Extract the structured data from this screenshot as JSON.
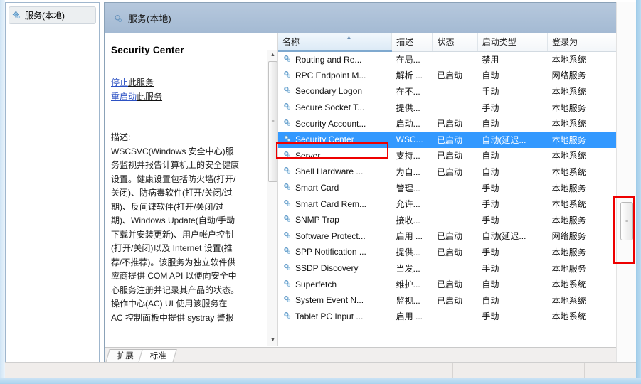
{
  "window": {
    "header_title": "服务(本地)",
    "header_icon": "service-gear-icon"
  },
  "tree": {
    "items": [
      {
        "label": "服务(本地)",
        "icon": "service-gear-icon"
      }
    ]
  },
  "detail": {
    "title": "Security Center",
    "links": [
      {
        "underlined": "停止",
        "rest": "此服务"
      },
      {
        "underlined": "重启动",
        "rest": "此服务"
      }
    ],
    "description_label": "描述:",
    "description_lines": [
      "WSCSVC(Windows 安全中心)服",
      "务监视并报告计算机上的安全健康",
      "设置。健康设置包括防火墙(打开/",
      "关闭)、防病毒软件(打开/关闭/过",
      "期)、反间谍软件(打开/关闭/过",
      "期)、Windows Update(自动/手动",
      "下载并安装更新)、用户帐户控制",
      "(打开/关闭)以及 Internet 设置(推",
      "荐/不推荐)。该服务为独立软件供",
      "应商提供 COM API 以便向安全中",
      "心服务注册并记录其产品的状态。",
      "操作中心(AC) UI 使用该服务在",
      "AC 控制面板中提供 systray 警报"
    ]
  },
  "list": {
    "columns": [
      {
        "label": "名称",
        "sorted": true,
        "sort_direction": "asc"
      },
      {
        "label": "描述",
        "sorted": false
      },
      {
        "label": "状态",
        "sorted": false
      },
      {
        "label": "启动类型",
        "sorted": false
      },
      {
        "label": "登录为",
        "sorted": false
      },
      {
        "label": "",
        "sorted": false
      }
    ],
    "rows": [
      {
        "name": "Routing and Re...",
        "description": "在局...",
        "status": "",
        "startup": "禁用",
        "logon": "本地系统",
        "selected": false
      },
      {
        "name": "RPC Endpoint M...",
        "description": "解析 ...",
        "status": "已启动",
        "startup": "自动",
        "logon": "网络服务",
        "selected": false
      },
      {
        "name": "Secondary Logon",
        "description": "在不...",
        "status": "",
        "startup": "手动",
        "logon": "本地系统",
        "selected": false
      },
      {
        "name": "Secure Socket T...",
        "description": "提供...",
        "status": "",
        "startup": "手动",
        "logon": "本地服务",
        "selected": false
      },
      {
        "name": "Security Account...",
        "description": "启动...",
        "status": "已启动",
        "startup": "自动",
        "logon": "本地系统",
        "selected": false
      },
      {
        "name": "Security Center",
        "description": "WSC...",
        "status": "已启动",
        "startup": "自动(延迟...",
        "logon": "本地服务",
        "selected": true
      },
      {
        "name": "Server",
        "description": "支持...",
        "status": "已启动",
        "startup": "自动",
        "logon": "本地系统",
        "selected": false
      },
      {
        "name": "Shell Hardware ...",
        "description": "为自...",
        "status": "已启动",
        "startup": "自动",
        "logon": "本地系统",
        "selected": false
      },
      {
        "name": "Smart Card",
        "description": "管理...",
        "status": "",
        "startup": "手动",
        "logon": "本地服务",
        "selected": false
      },
      {
        "name": "Smart Card Rem...",
        "description": "允许...",
        "status": "",
        "startup": "手动",
        "logon": "本地系统",
        "selected": false
      },
      {
        "name": "SNMP Trap",
        "description": "接收...",
        "status": "",
        "startup": "手动",
        "logon": "本地服务",
        "selected": false
      },
      {
        "name": "Software Protect...",
        "description": "启用 ...",
        "status": "已启动",
        "startup": "自动(延迟...",
        "logon": "网络服务",
        "selected": false
      },
      {
        "name": "SPP Notification ...",
        "description": "提供...",
        "status": "已启动",
        "startup": "手动",
        "logon": "本地服务",
        "selected": false
      },
      {
        "name": "SSDP Discovery",
        "description": "当发...",
        "status": "",
        "startup": "手动",
        "logon": "本地服务",
        "selected": false
      },
      {
        "name": "Superfetch",
        "description": "维护...",
        "status": "已启动",
        "startup": "自动",
        "logon": "本地系统",
        "selected": false
      },
      {
        "name": "System Event N...",
        "description": "监视...",
        "status": "已启动",
        "startup": "自动",
        "logon": "本地系统",
        "selected": false
      },
      {
        "name": "Tablet PC Input ...",
        "description": "启用 ...",
        "status": "",
        "startup": "手动",
        "logon": "本地系统",
        "selected": false
      }
    ]
  },
  "tabs": [
    {
      "label": "扩展",
      "active": false
    },
    {
      "label": "标准",
      "active": true
    }
  ],
  "statusbar": {
    "cells": [
      "",
      "",
      ""
    ]
  },
  "colors": {
    "selection_blue": "#3399ff",
    "header_banner": "#a4bad3",
    "link_blue": "#2d52c4",
    "annotation_red": "#ee0000"
  }
}
